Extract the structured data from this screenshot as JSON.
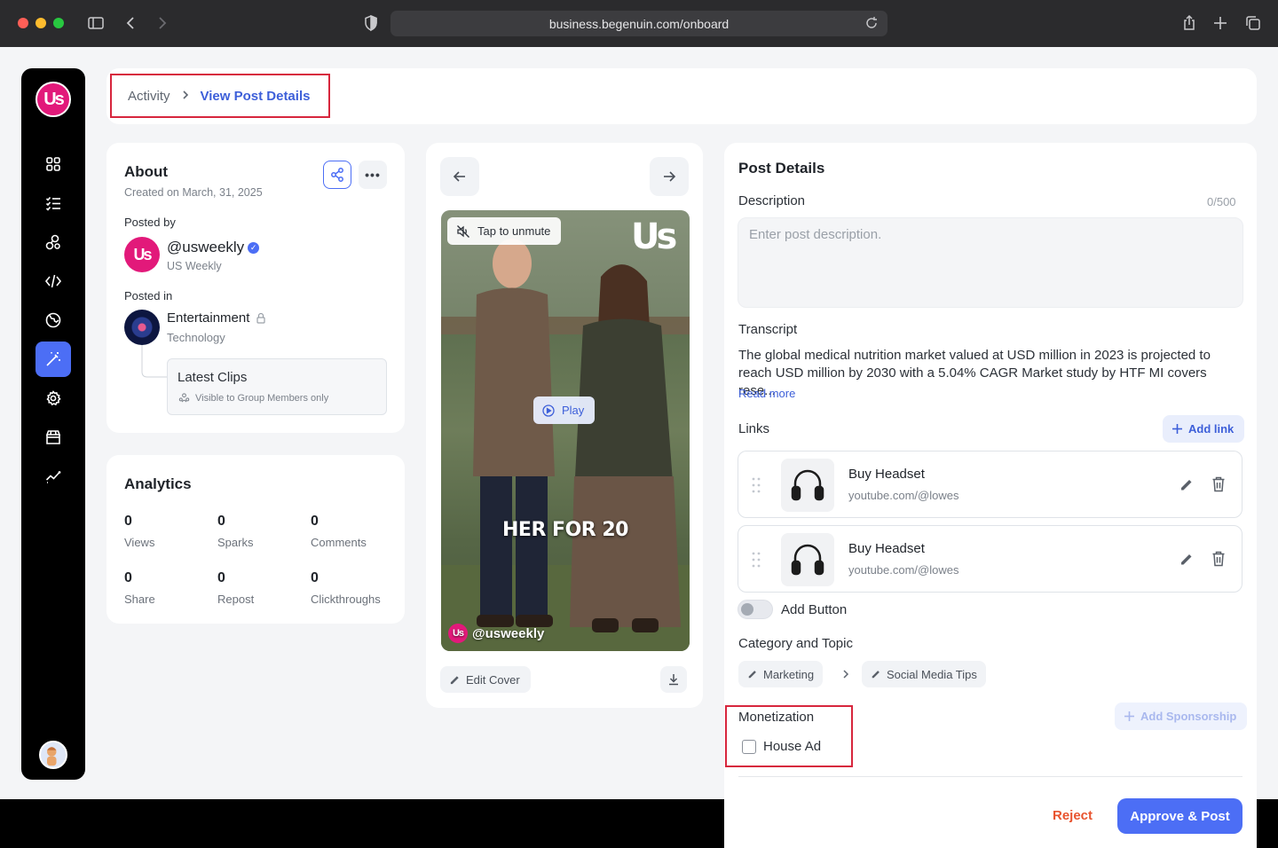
{
  "browser": {
    "url": "business.begenuin.com/onboard"
  },
  "sidebar": {
    "logo_text": "Us",
    "items": [
      {
        "icon": "grid-icon"
      },
      {
        "icon": "list-icon"
      },
      {
        "icon": "community-icon"
      },
      {
        "icon": "code-icon"
      },
      {
        "icon": "globe-icon"
      },
      {
        "icon": "magic-wand-icon",
        "active": true
      },
      {
        "icon": "settings-icon"
      },
      {
        "icon": "store-icon"
      },
      {
        "icon": "analytics-icon"
      }
    ]
  },
  "breadcrumb": {
    "parent": "Activity",
    "current": "View Post Details"
  },
  "about": {
    "title": "About",
    "created": "Created on March, 31, 2025",
    "posted_by_label": "Posted by",
    "handle": "@usweekly",
    "display_name": "US Weekly",
    "posted_in_label": "Posted in",
    "community": "Entertainment",
    "community_category": "Technology",
    "group": "Latest Clips",
    "group_visibility": "Visible to Group Members only"
  },
  "analytics": {
    "title": "Analytics",
    "stats": [
      {
        "value": "0",
        "label": "Views"
      },
      {
        "value": "0",
        "label": "Sparks"
      },
      {
        "value": "0",
        "label": "Comments"
      },
      {
        "value": "0",
        "label": "Share"
      },
      {
        "value": "0",
        "label": "Repost"
      },
      {
        "value": "0",
        "label": "Clickthroughs"
      }
    ]
  },
  "media": {
    "unmute_label": "Tap to unmute",
    "play_label": "Play",
    "caption": "HER FOR 20",
    "watermark_logo": "Us",
    "watermark_handle": "@usweekly",
    "edit_cover_label": "Edit Cover"
  },
  "details": {
    "title": "Post Details",
    "description_label": "Description",
    "description_counter": "0/500",
    "description_placeholder": "Enter post description.",
    "transcript_label": "Transcript",
    "transcript_text": "The global medical nutrition market valued at USD million in 2023 is projected to reach USD million by 2030 with a 5.04% CAGR Market study by HTF MI covers rese...",
    "read_more": "Read more",
    "links_label": "Links",
    "add_link_label": "Add link",
    "links": [
      {
        "title": "Buy Headset",
        "url": "youtube.com/@lowes"
      },
      {
        "title": "Buy Headset",
        "url": "youtube.com/@lowes"
      }
    ],
    "add_button_label": "Add Button",
    "category_label": "Category and Topic",
    "category": "Marketing",
    "topic": "Social Media Tips",
    "monetization_label": "Monetization",
    "add_sponsorship_label": "Add Sponsorship",
    "house_ad_label": "House Ad",
    "reject_label": "Reject",
    "approve_label": "Approve & Post"
  },
  "colors": {
    "accent": "#4c6ef5",
    "reject": "#e8532e",
    "brand": "#e2197a",
    "highlight": "#d7263d"
  }
}
